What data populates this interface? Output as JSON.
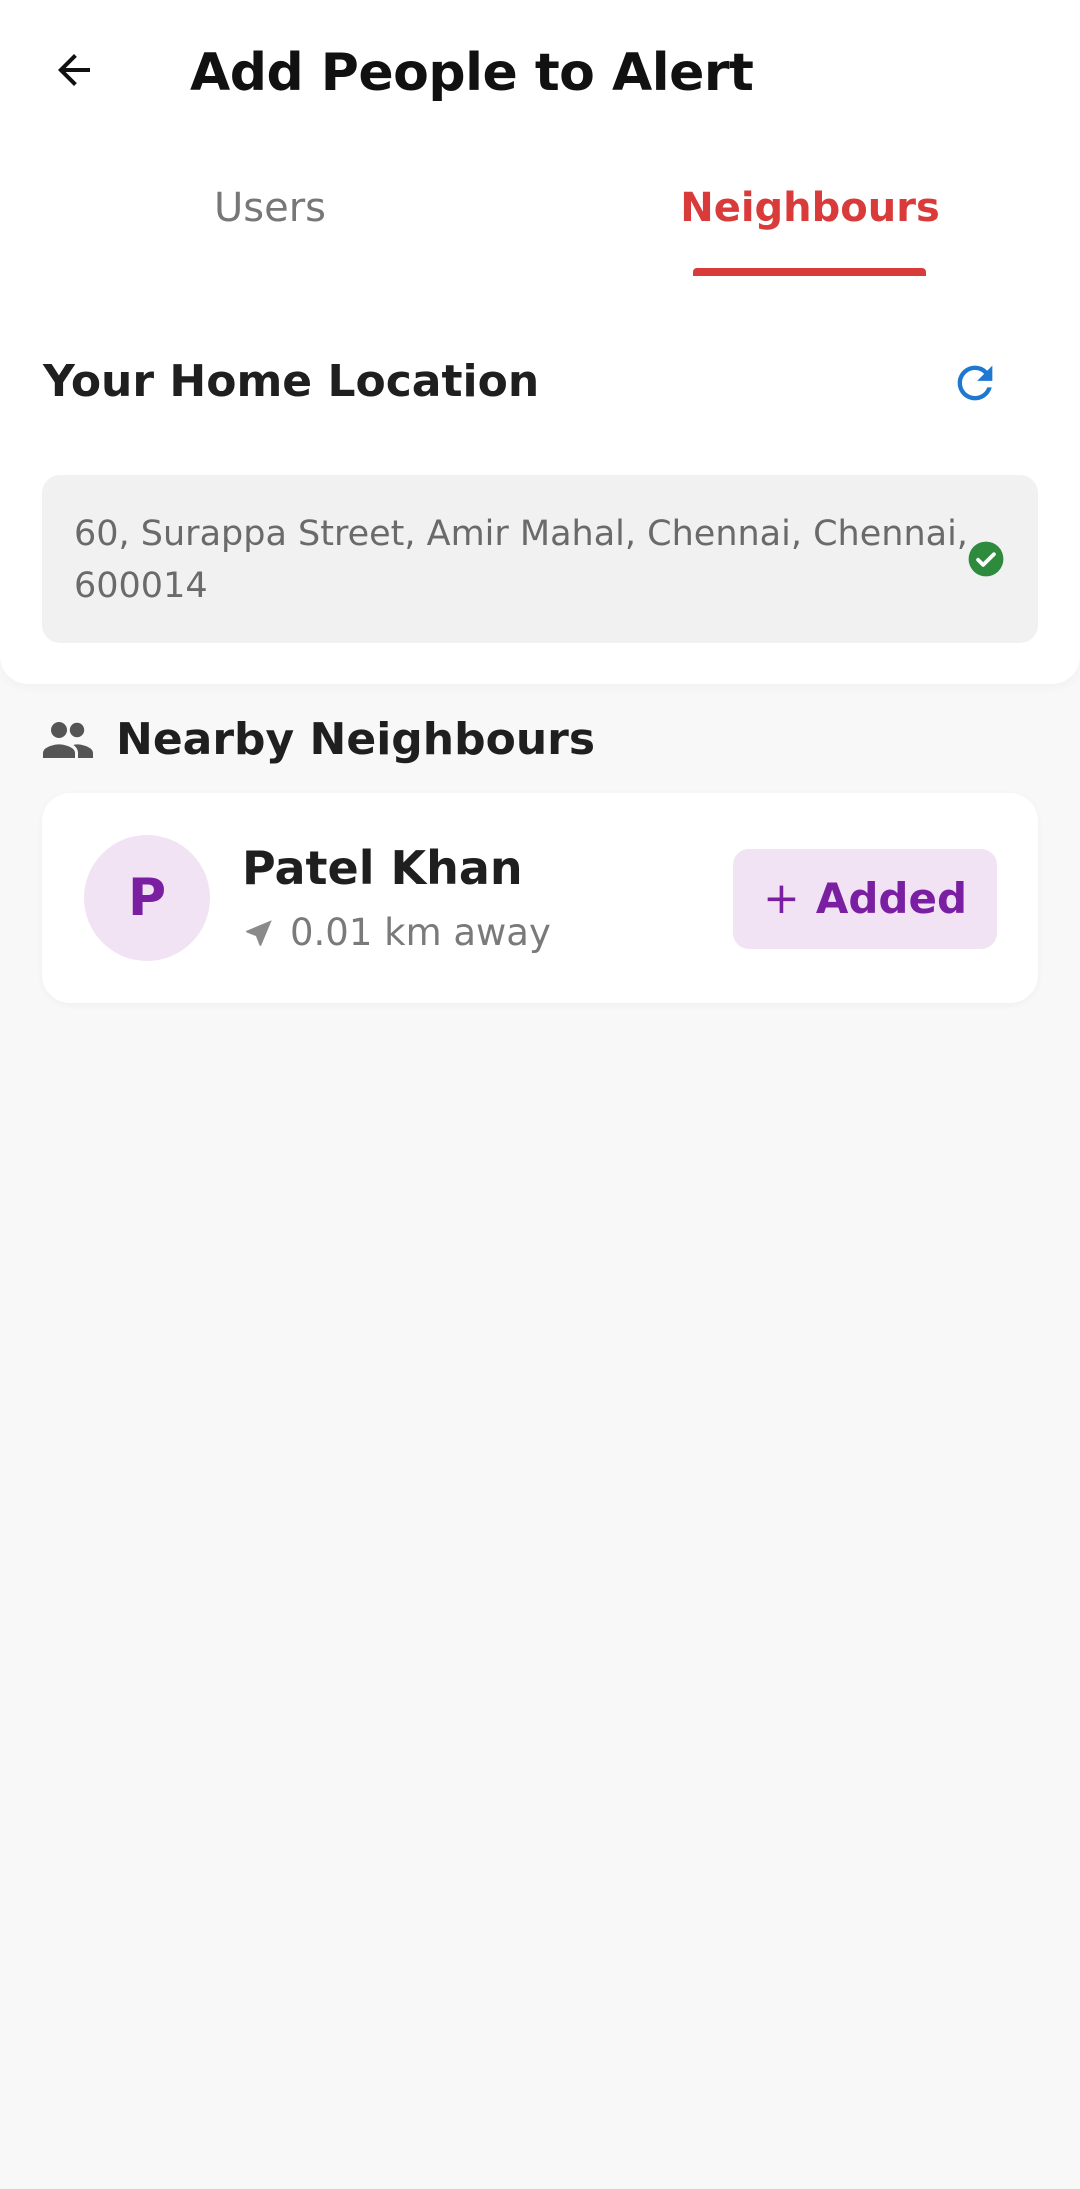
{
  "header": {
    "title": "Add People to Alert",
    "back_icon": "arrow-left-icon"
  },
  "tabs": [
    {
      "label": "Users",
      "selected": false
    },
    {
      "label": "Neighbours",
      "selected": true
    }
  ],
  "home_location": {
    "title": "Your Home Location",
    "refresh_icon": "refresh-icon",
    "address": "60, Surappa Street, Amir Mahal, Chennai, Chennai, 600014",
    "verified_icon": "check-circle-icon"
  },
  "nearby": {
    "title": "Nearby Neighbours",
    "icon": "people-icon",
    "neighbours": [
      {
        "initial": "P",
        "name": "Patel Khan",
        "distance": "0.01 km away",
        "action_icon": "+",
        "action_label": "Added"
      }
    ]
  },
  "colors": {
    "accent_red": "#d93a3a",
    "accent_purple": "#7b1fa2",
    "avatar_bg": "#f1e2f4",
    "verified_green": "#2e8b3e",
    "refresh_blue": "#1e78d2"
  }
}
